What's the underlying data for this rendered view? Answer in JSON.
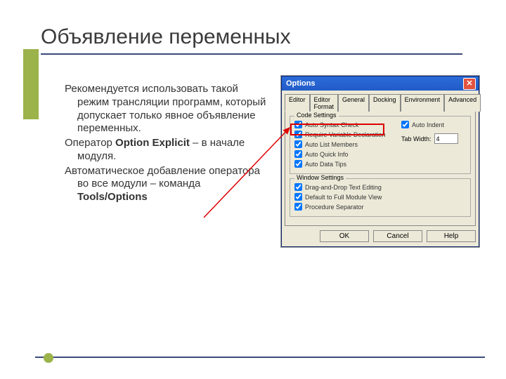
{
  "slide": {
    "title": "Объявление переменных",
    "para1": "Рекомендуется использовать такой режим трансляции программ, который допускает только явное объявление переменных.",
    "para2_a": "Оператор ",
    "para2_b": "Option Explicit",
    "para2_c": " – в начале модуля.",
    "para3_a": "Автоматическое добавление оператора во все модули – команда ",
    "para3_b": "Tools/Options"
  },
  "dialog": {
    "title": "Options",
    "tabs": [
      "Editor",
      "Editor Format",
      "General",
      "Docking",
      "Environment",
      "Advanced"
    ],
    "group1": "Code Settings",
    "group2": "Window Settings",
    "checks_left": [
      "Auto Syntax Check",
      "Require Variable Declaration",
      "Auto List Members",
      "Auto Quick Info",
      "Auto Data Tips"
    ],
    "checks_right_label": "Auto Indent",
    "tabwidth_label": "Tab Width:",
    "tabwidth_value": "4",
    "window_checks": [
      "Drag-and-Drop Text Editing",
      "Default to Full Module View",
      "Procedure Separator"
    ],
    "buttons": {
      "ok": "OK",
      "cancel": "Cancel",
      "help": "Help"
    }
  }
}
